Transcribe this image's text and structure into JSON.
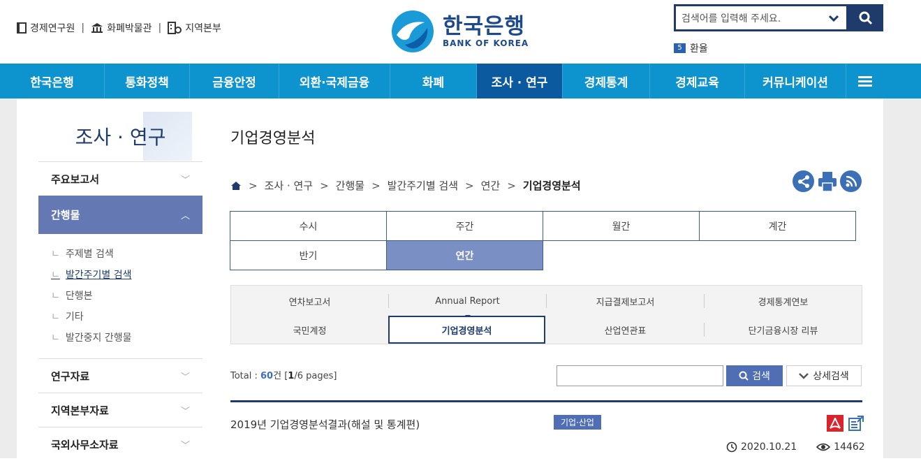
{
  "util_links": [
    "경제연구원",
    "화폐박물관",
    "지역본부"
  ],
  "logo": {
    "ko": "한국은행",
    "en": "BANK OF KOREA"
  },
  "search": {
    "placeholder": "검색어를 입력해 주세요."
  },
  "ranking": {
    "num": "5",
    "text": "환율"
  },
  "gnb": [
    "한국은행",
    "통화정책",
    "금융안정",
    "외환·국제금융",
    "화폐",
    "조사 · 연구",
    "경제통계",
    "경제교육",
    "커뮤니케이션"
  ],
  "lnb": {
    "title": "조사 · 연구",
    "groups": [
      "주요보고서",
      "간행물",
      "연구자료",
      "지역본부자료",
      "국외사무소자료"
    ],
    "subs": [
      "주제별 검색",
      "발간주기별 검색",
      "단행본",
      "기타",
      "발간중지 간행물"
    ]
  },
  "page_title": "기업경영분석",
  "breadcrumb": [
    "조사 · 연구",
    "간행물",
    "발간주기별 검색",
    "연간",
    "기업경영분석"
  ],
  "period_tabs": [
    "수시",
    "주간",
    "월간",
    "계간",
    "반기",
    "연간"
  ],
  "pub_tabs": [
    "연차보고서",
    "Annual Report",
    "지급결제보고서",
    "경제통계연보",
    "국민계정",
    "기업경영분석",
    "산업연관표",
    "단기금융시장 리뷰"
  ],
  "total": {
    "label": "Total : ",
    "count": "60",
    "unit": "건 [",
    "page": "1",
    "pages": "/6 pages]"
  },
  "buttons": {
    "search": "검색",
    "advanced": "상세검색"
  },
  "item": {
    "title": "2019년 기업경영분석결과(해설 및 통계편)",
    "tag": "기업·산업",
    "date": "2020.10.21",
    "views": "14462"
  }
}
